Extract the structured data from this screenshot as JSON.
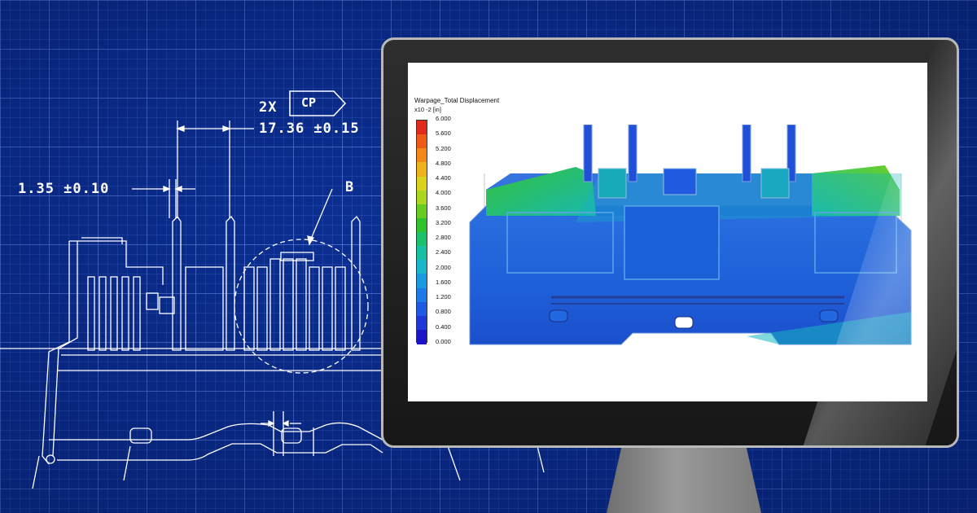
{
  "drawing": {
    "dim_top_prefix": "2X",
    "dim_top_tag": "CP",
    "dim_top_value": "17.36 ±0.15",
    "dim_left_value": "1.35 ±0.10",
    "detail_label": "B"
  },
  "screen": {
    "legend_title": "Warpage_Total Displacement",
    "legend_unit": "x10  -2 [in]",
    "legend_values": [
      "6.000",
      "5.600",
      "5.200",
      "4.800",
      "4.400",
      "4.000",
      "3.600",
      "3.200",
      "2.800",
      "2.400",
      "2.000",
      "1.600",
      "1.200",
      "0.800",
      "0.400",
      "0.000"
    ],
    "legend_colors": [
      "#e02a1a",
      "#ef5a18",
      "#f5861a",
      "#f0b21a",
      "#d8d21c",
      "#a9d61e",
      "#66cc22",
      "#2fc22c",
      "#1cbf6a",
      "#18c0a2",
      "#17b7c9",
      "#1a9be0",
      "#1d7ae8",
      "#1f58e2",
      "#1f36d8",
      "#1b14c8"
    ]
  },
  "colors": {
    "background": "#0b2f93",
    "monitor_bezel": "#1f1f1f",
    "screen": "#ffffff"
  }
}
